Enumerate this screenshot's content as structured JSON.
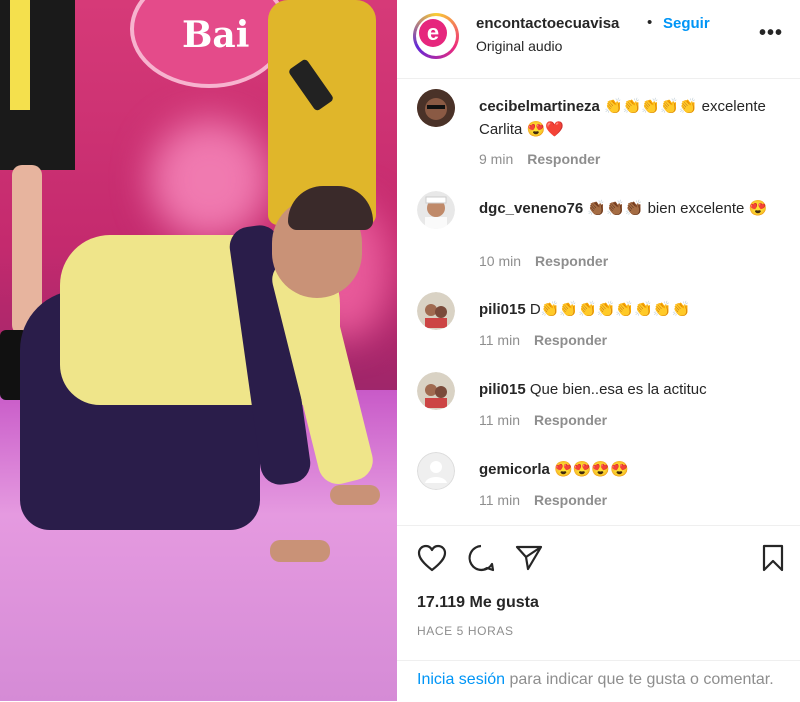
{
  "header": {
    "username": "encontactoecuavisa",
    "separator": "•",
    "follow_label": "Seguir",
    "audio_label": "Original audio",
    "more_label": "•••",
    "logo_letter": "e"
  },
  "media": {
    "sign_text": "Bai"
  },
  "comments": [
    {
      "username": "cecibelmartineza",
      "text": " 👏👏👏👏👏 excelente Carlita 😍❤️",
      "time": "9 min",
      "reply": "Responder"
    },
    {
      "username": "dgc_veneno76",
      "text": " 👏🏾👏🏾👏🏾 bien excelente 😍",
      "time": "10 min",
      "reply": "Responder"
    },
    {
      "username": "pili015",
      "text": " D👏👏👏👏👏👏👏👏",
      "time": "11 min",
      "reply": "Responder"
    },
    {
      "username": "pili015",
      "text": " Que bien..esa es la actituc",
      "time": "11 min",
      "reply": "Responder"
    },
    {
      "username": "gemicorla",
      "text": " 😍😍😍😍",
      "time": "11 min",
      "reply": "Responder"
    }
  ],
  "footer": {
    "likes": "17.119 Me gusta",
    "posted": "HACE 5 HORAS",
    "login_link": "Inicia sesión",
    "login_text": " para indicar que te gusta o comentar."
  },
  "colors": {
    "accent": "#0095f6",
    "text": "#262626",
    "muted": "#8e8e8e"
  }
}
